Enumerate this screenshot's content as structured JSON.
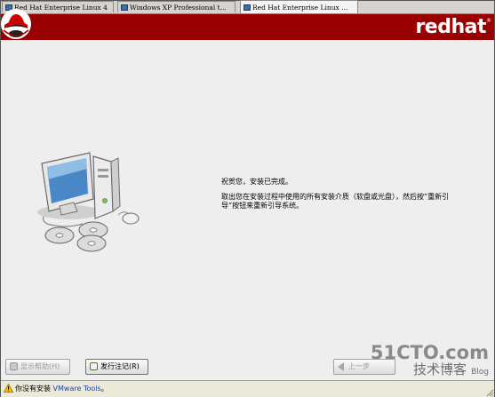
{
  "tabs": [
    {
      "label": "Red Hat Enterprise Linux 4",
      "active": false
    },
    {
      "label": "Windows XP Professional t...",
      "active": false
    },
    {
      "label": "Red Hat Enterprise Linux ...",
      "active": true
    }
  ],
  "header": {
    "brand": "redhat",
    "brand_mark": "®"
  },
  "message": {
    "line1": "祝贺您，安装已完成。",
    "line2": "取出您在安装过程中使用的所有安装介质（软盘或光盘），然后按“重新引导”按钮来重新引导系统。"
  },
  "buttons": {
    "help": "显示帮助(H)",
    "release_notes": "发行注记(R)",
    "back": "上一步"
  },
  "watermark": {
    "main": "51CTO.com",
    "sub": "技术博客",
    "blog": "Blog"
  },
  "statusbar": {
    "prefix": "你没有安装 ",
    "link": "VMware Tools",
    "suffix": "。"
  },
  "colors": {
    "header_red": "#990000",
    "background": "#eeeeee"
  }
}
